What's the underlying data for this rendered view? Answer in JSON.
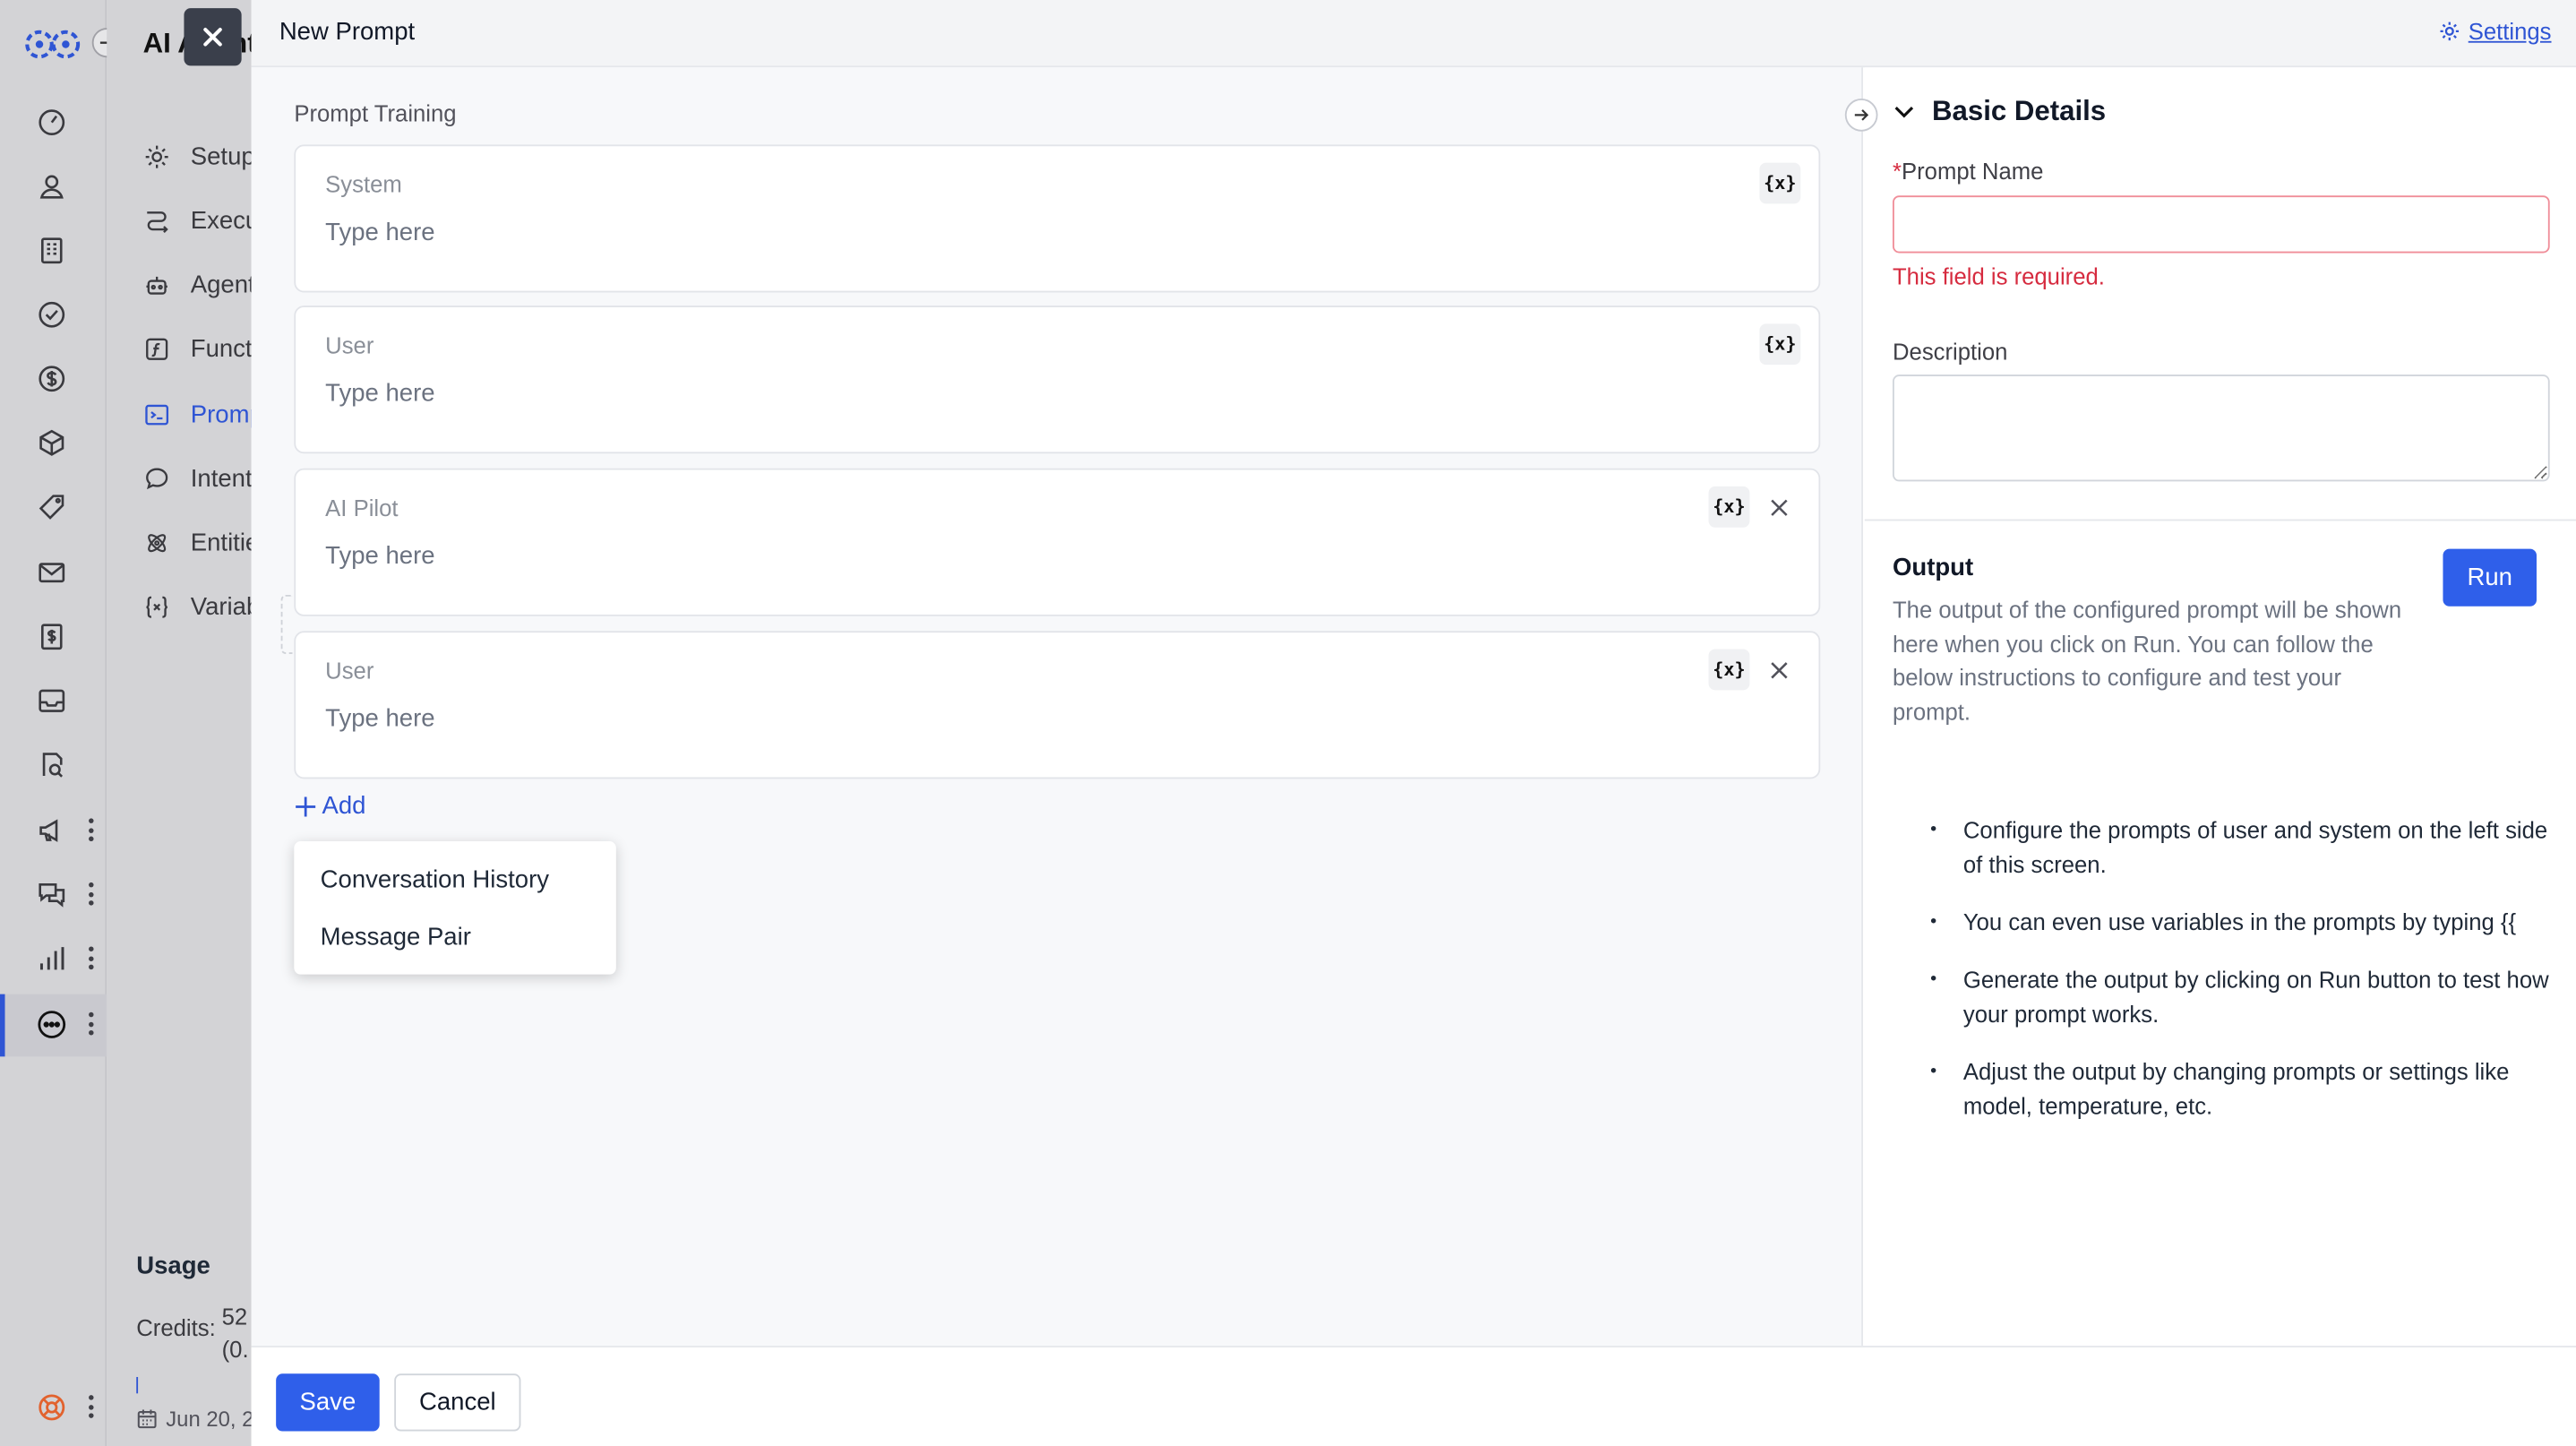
{
  "app": {
    "title": "AI Agents"
  },
  "rail": {
    "icons": [
      "dashboard-icon",
      "user-icon",
      "building-icon",
      "check-circle-icon",
      "dollar-circle-icon",
      "cube-icon",
      "tag-icon",
      "mail-icon",
      "invoice-icon",
      "inbox-icon",
      "report-icon",
      "megaphone-icon",
      "chat-icon",
      "bar-chart-icon",
      "ai-bubble-icon",
      "lifebuoy-icon"
    ]
  },
  "sidebar": {
    "items": [
      {
        "label": "Setup",
        "icon": "gear-icon"
      },
      {
        "label": "Executions",
        "icon": "flow-icon"
      },
      {
        "label": "Agents",
        "icon": "robot-icon"
      },
      {
        "label": "Functions",
        "icon": "function-icon"
      },
      {
        "label": "Prompts",
        "icon": "terminal-icon"
      },
      {
        "label": "Intents",
        "icon": "speech-icon"
      },
      {
        "label": "Entities",
        "icon": "atom-icon"
      },
      {
        "label": "Variables",
        "icon": "braces-icon"
      }
    ],
    "usage_title": "Usage",
    "credits_label": "Credits:",
    "credits_value": "52",
    "credits_sub": "(0.",
    "date": "Jun 20, 2"
  },
  "drawer": {
    "title": "New Prompt",
    "settings_label": "Settings"
  },
  "training": {
    "label": "Prompt Training",
    "var_symbol": "{x}",
    "messages": [
      {
        "role": "System",
        "placeholder": "Type here",
        "removable": false
      },
      {
        "role": "User",
        "placeholder": "Type here",
        "removable": false
      },
      {
        "role": "AI Pilot",
        "placeholder": "Type here",
        "removable": true
      },
      {
        "role": "User",
        "placeholder": "Type here",
        "removable": true
      }
    ],
    "add_label": "Add",
    "add_menu": [
      "Conversation History",
      "Message Pair"
    ]
  },
  "details": {
    "title": "Basic Details",
    "prompt_name_label": "Prompt Name",
    "required_mark": "*",
    "prompt_name_value": "",
    "error": "This field is required.",
    "description_label": "Description",
    "description_value": ""
  },
  "output": {
    "title": "Output",
    "description": "The output of the configured prompt will be shown here when you click on Run. You can follow the below instructions to configure and test your prompt.",
    "run_label": "Run",
    "instructions": [
      "Configure the prompts of user and system on the left side of this screen.",
      "You can even use variables in the prompts by typing {{",
      "Generate the output by clicking on Run button to test how your prompt works.",
      "Adjust the output by changing prompts or settings like model, temperature, etc."
    ]
  },
  "footer": {
    "save_label": "Save",
    "cancel_label": "Cancel"
  },
  "colors": {
    "accent": "#2f5fea",
    "error": "#d62b3f",
    "rail": "#d3d3d6"
  }
}
